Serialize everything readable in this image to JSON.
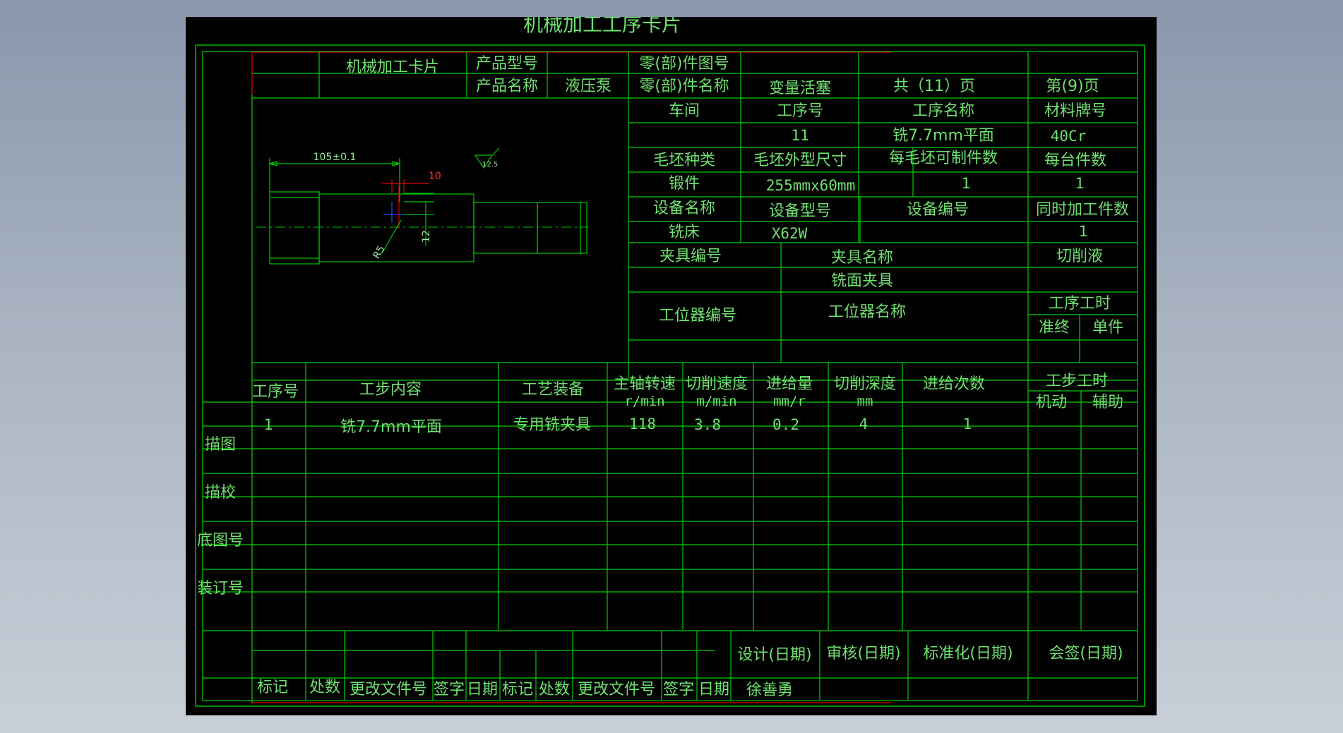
{
  "doc_title": "机械加工工序卡片",
  "header": {
    "card_name": "机械加工卡片",
    "product_model_label": "产品型号",
    "product_model_value": "",
    "part_drawing_no_label": "零(部)件图号",
    "part_drawing_no_value": "",
    "product_name_label": "产品名称",
    "product_name_value": "液压泵",
    "part_name_label": "零(部)件名称",
    "part_name_value": "变量活塞",
    "total_pages": "共（11）页",
    "page_no": "第(9)页"
  },
  "info": {
    "workshop_label": "车间",
    "workshop_value": "",
    "process_no_label": "工序号",
    "process_no_value": "11",
    "process_name_label": "工序名称",
    "process_name_value": "铣7.7mm平面",
    "material_label": "材料牌号",
    "material_value": "40Cr",
    "blank_type_label": "毛坯种类",
    "blank_type_value": "锻件",
    "blank_size_label": "毛坯外型尺寸",
    "blank_size_value": "255mmx60mm",
    "parts_per_blank_label": "每毛坯可制件数",
    "parts_per_blank_value": "1",
    "parts_per_unit_label": "每台件数",
    "parts_per_unit_value": "1",
    "equipment_name_label": "设备名称",
    "equipment_name_value": "铣床",
    "equipment_model_label": "设备型号",
    "equipment_model_value": "X62W",
    "equipment_no_label": "设备编号",
    "equipment_no_value": "",
    "simul_parts_label": "同时加工件数",
    "simul_parts_value": "1",
    "fixture_no_label": "夹具编号",
    "fixture_name_label": "夹具名称",
    "fixture_name_value": "铣面夹具",
    "coolant_label": "切削液",
    "station_no_label": "工位器编号",
    "station_name_label": "工位器名称",
    "process_time_label": "工序工时",
    "prep_end_label": "准终",
    "single_label": "单件"
  },
  "sketch": {
    "dim_length": "105±0.1",
    "dim_red": "10",
    "surface_roughness": "12.5",
    "radius": "R5",
    "dim_side": "12"
  },
  "steps_header": {
    "step_no": "工序号",
    "step_content": "工步内容",
    "tooling": "工艺装备",
    "spindle_speed": "主轴转速",
    "spindle_speed_unit": "r/min",
    "cutting_speed": "切削速度",
    "cutting_speed_unit": "m/min",
    "feed": "进给量",
    "feed_unit": "mm/r",
    "cut_depth": "切削深度",
    "cut_depth_unit": "mm",
    "feed_times": "进给次数",
    "step_time": "工步工时",
    "machine_time": "机动",
    "aux_time": "辅助"
  },
  "steps": [
    {
      "no": "1",
      "content": "铣7.7mm平面",
      "tooling": "专用铣夹具",
      "spindle": "118",
      "speed": "3.8",
      "feed": "0.2",
      "depth": "4",
      "times": "1"
    }
  ],
  "side_labels": [
    "描图",
    "描校",
    "底图号",
    "装订号"
  ],
  "footer": {
    "mark1": "标记",
    "count1": "处数",
    "doc_no1": "更改文件号",
    "sign1": "签字",
    "date1": "日期",
    "mark2": "标记",
    "count2": "处数",
    "doc_no2": "更改文件号",
    "sign2": "签字",
    "date2": "日期",
    "design": "设计(日期)",
    "review": "审核(日期)",
    "standard": "标准化(日期)",
    "countersign": "会签(日期)",
    "designer": "徐善勇"
  },
  "colors": {
    "line": "#00d000",
    "border_red": "#e00000",
    "text": "#6fe06f",
    "background": "#000000"
  }
}
